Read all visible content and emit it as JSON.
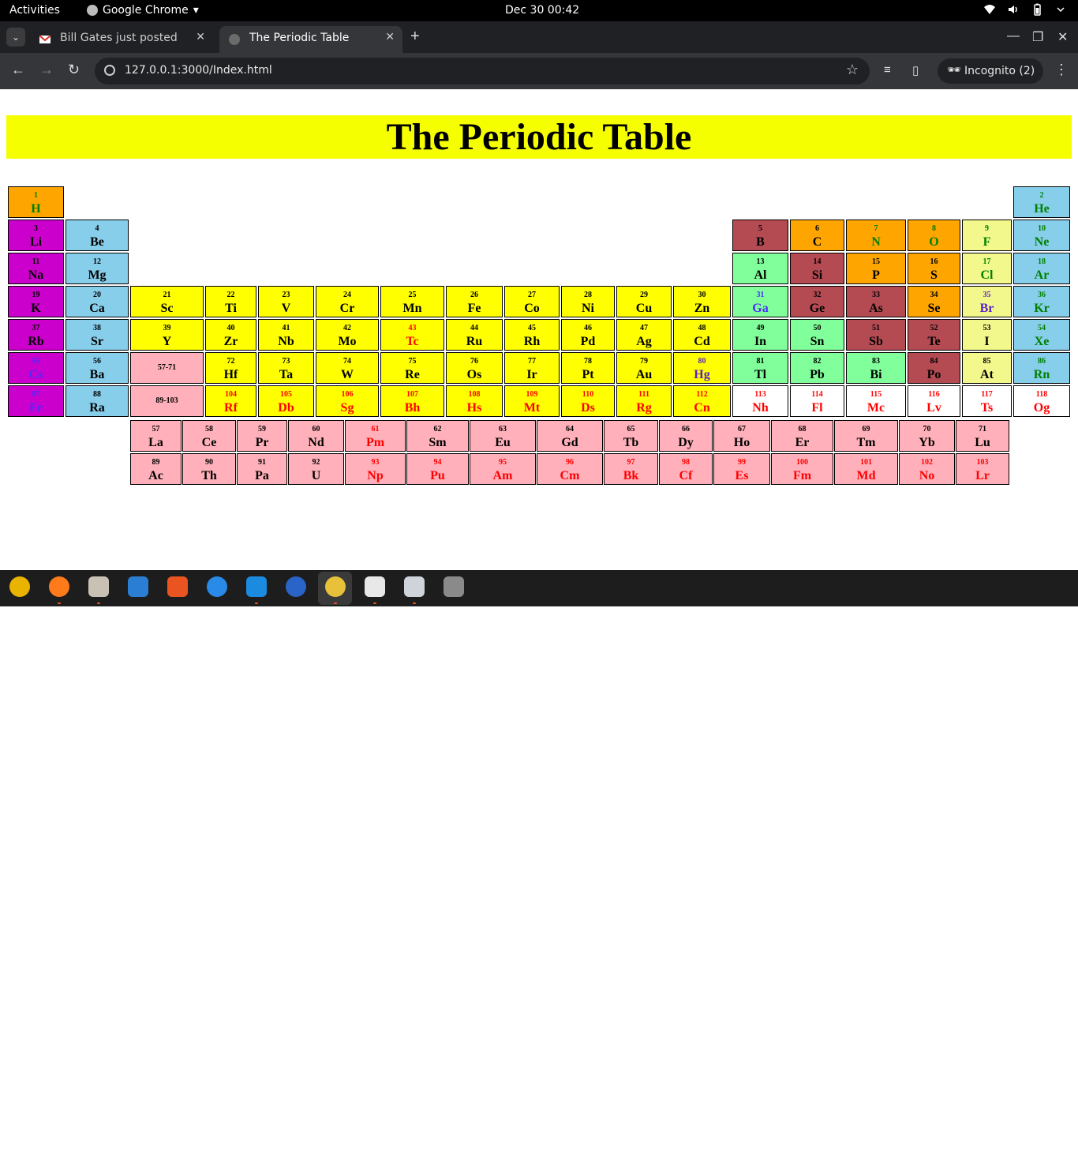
{
  "system_bar": {
    "activities": "Activities",
    "app_name": "Google Chrome",
    "clock": "Dec 30  00:42"
  },
  "tabs": [
    {
      "title": "Bill Gates just posted. Re",
      "active": false,
      "icon": "gmail-icon"
    },
    {
      "title": "The Periodic Table",
      "active": true,
      "icon": "globe-icon"
    }
  ],
  "toolbar": {
    "url": "127.0.0.1:3000/Index.html",
    "profile_label": "Incognito (2)"
  },
  "page": {
    "title": "The Periodic Table",
    "placeholder_lanthanides": "57-71",
    "placeholder_actinides": "89-103"
  },
  "colors": {
    "banner": "#f5ff00",
    "alkali_metal": "#cc00cc",
    "alkaline_earth": "#87ceeb",
    "transition_metal": "#ffff00",
    "post_transition": "#80ff9a",
    "metalloid": "#b44a52",
    "nonmetal": "#ffa500",
    "halogen": "#f2f88c",
    "noble_gas": "#87ceeb",
    "lanthanide_actinide": "#ffb0ba",
    "unknown": "#ffffff"
  },
  "elements": [
    {
      "n": "1",
      "s": "H",
      "p": 1,
      "g": 1,
      "bg": "orange",
      "tc": "green"
    },
    {
      "n": "2",
      "s": "He",
      "p": 1,
      "g": 18,
      "bg": "lightblue",
      "tc": "green"
    },
    {
      "n": "3",
      "s": "Li",
      "p": 2,
      "g": 1,
      "bg": "magenta",
      "tc": "black"
    },
    {
      "n": "4",
      "s": "Be",
      "p": 2,
      "g": 2,
      "bg": "lightblue",
      "tc": "black"
    },
    {
      "n": "5",
      "s": "B",
      "p": 2,
      "g": 13,
      "bg": "brown",
      "tc": "black"
    },
    {
      "n": "6",
      "s": "C",
      "p": 2,
      "g": 14,
      "bg": "orange",
      "tc": "black"
    },
    {
      "n": "7",
      "s": "N",
      "p": 2,
      "g": 15,
      "bg": "orange",
      "tc": "green"
    },
    {
      "n": "8",
      "s": "O",
      "p": 2,
      "g": 16,
      "bg": "orange",
      "tc": "green"
    },
    {
      "n": "9",
      "s": "F",
      "p": 2,
      "g": 17,
      "bg": "paleyellow",
      "tc": "green"
    },
    {
      "n": "10",
      "s": "Ne",
      "p": 2,
      "g": 18,
      "bg": "lightblue",
      "tc": "green"
    },
    {
      "n": "11",
      "s": "Na",
      "p": 3,
      "g": 1,
      "bg": "magenta",
      "tc": "black"
    },
    {
      "n": "12",
      "s": "Mg",
      "p": 3,
      "g": 2,
      "bg": "lightblue",
      "tc": "black"
    },
    {
      "n": "13",
      "s": "Al",
      "p": 3,
      "g": 13,
      "bg": "green",
      "tc": "black"
    },
    {
      "n": "14",
      "s": "Si",
      "p": 3,
      "g": 14,
      "bg": "brown",
      "tc": "black"
    },
    {
      "n": "15",
      "s": "P",
      "p": 3,
      "g": 15,
      "bg": "orange",
      "tc": "black"
    },
    {
      "n": "16",
      "s": "S",
      "p": 3,
      "g": 16,
      "bg": "orange",
      "tc": "black"
    },
    {
      "n": "17",
      "s": "Cl",
      "p": 3,
      "g": 17,
      "bg": "paleyellow",
      "tc": "green"
    },
    {
      "n": "18",
      "s": "Ar",
      "p": 3,
      "g": 18,
      "bg": "lightblue",
      "tc": "green"
    },
    {
      "n": "19",
      "s": "K",
      "p": 4,
      "g": 1,
      "bg": "magenta",
      "tc": "black"
    },
    {
      "n": "20",
      "s": "Ca",
      "p": 4,
      "g": 2,
      "bg": "lightblue",
      "tc": "black"
    },
    {
      "n": "21",
      "s": "Sc",
      "p": 4,
      "g": 3,
      "bg": "yellow",
      "tc": "black"
    },
    {
      "n": "22",
      "s": "Ti",
      "p": 4,
      "g": 4,
      "bg": "yellow",
      "tc": "black"
    },
    {
      "n": "23",
      "s": "V",
      "p": 4,
      "g": 5,
      "bg": "yellow",
      "tc": "black"
    },
    {
      "n": "24",
      "s": "Cr",
      "p": 4,
      "g": 6,
      "bg": "yellow",
      "tc": "black"
    },
    {
      "n": "25",
      "s": "Mn",
      "p": 4,
      "g": 7,
      "bg": "yellow",
      "tc": "black"
    },
    {
      "n": "26",
      "s": "Fe",
      "p": 4,
      "g": 8,
      "bg": "yellow",
      "tc": "black"
    },
    {
      "n": "27",
      "s": "Co",
      "p": 4,
      "g": 9,
      "bg": "yellow",
      "tc": "black"
    },
    {
      "n": "28",
      "s": "Ni",
      "p": 4,
      "g": 10,
      "bg": "yellow",
      "tc": "black"
    },
    {
      "n": "29",
      "s": "Cu",
      "p": 4,
      "g": 11,
      "bg": "yellow",
      "tc": "black"
    },
    {
      "n": "30",
      "s": "Zn",
      "p": 4,
      "g": 12,
      "bg": "yellow",
      "tc": "black"
    },
    {
      "n": "31",
      "s": "Ga",
      "p": 4,
      "g": 13,
      "bg": "green",
      "tc": "blue"
    },
    {
      "n": "32",
      "s": "Ge",
      "p": 4,
      "g": 14,
      "bg": "brown",
      "tc": "black"
    },
    {
      "n": "33",
      "s": "As",
      "p": 4,
      "g": 15,
      "bg": "brown",
      "tc": "black"
    },
    {
      "n": "34",
      "s": "Se",
      "p": 4,
      "g": 16,
      "bg": "orange",
      "tc": "black"
    },
    {
      "n": "35",
      "s": "Br",
      "p": 4,
      "g": 17,
      "bg": "paleyellow",
      "tc": "purple"
    },
    {
      "n": "36",
      "s": "Kr",
      "p": 4,
      "g": 18,
      "bg": "lightblue",
      "tc": "green"
    },
    {
      "n": "37",
      "s": "Rb",
      "p": 5,
      "g": 1,
      "bg": "magenta",
      "tc": "black"
    },
    {
      "n": "38",
      "s": "Sr",
      "p": 5,
      "g": 2,
      "bg": "lightblue",
      "tc": "black"
    },
    {
      "n": "39",
      "s": "Y",
      "p": 5,
      "g": 3,
      "bg": "yellow",
      "tc": "black"
    },
    {
      "n": "40",
      "s": "Zr",
      "p": 5,
      "g": 4,
      "bg": "yellow",
      "tc": "black"
    },
    {
      "n": "41",
      "s": "Nb",
      "p": 5,
      "g": 5,
      "bg": "yellow",
      "tc": "black"
    },
    {
      "n": "42",
      "s": "Mo",
      "p": 5,
      "g": 6,
      "bg": "yellow",
      "tc": "black"
    },
    {
      "n": "43",
      "s": "Tc",
      "p": 5,
      "g": 7,
      "bg": "yellow",
      "tc": "red"
    },
    {
      "n": "44",
      "s": "Ru",
      "p": 5,
      "g": 8,
      "bg": "yellow",
      "tc": "black"
    },
    {
      "n": "45",
      "s": "Rh",
      "p": 5,
      "g": 9,
      "bg": "yellow",
      "tc": "black"
    },
    {
      "n": "46",
      "s": "Pd",
      "p": 5,
      "g": 10,
      "bg": "yellow",
      "tc": "black"
    },
    {
      "n": "47",
      "s": "Ag",
      "p": 5,
      "g": 11,
      "bg": "yellow",
      "tc": "black"
    },
    {
      "n": "48",
      "s": "Cd",
      "p": 5,
      "g": 12,
      "bg": "yellow",
      "tc": "black"
    },
    {
      "n": "49",
      "s": "In",
      "p": 5,
      "g": 13,
      "bg": "green",
      "tc": "black"
    },
    {
      "n": "50",
      "s": "Sn",
      "p": 5,
      "g": 14,
      "bg": "green",
      "tc": "black"
    },
    {
      "n": "51",
      "s": "Sb",
      "p": 5,
      "g": 15,
      "bg": "brown",
      "tc": "black"
    },
    {
      "n": "52",
      "s": "Te",
      "p": 5,
      "g": 16,
      "bg": "brown",
      "tc": "black"
    },
    {
      "n": "53",
      "s": "I",
      "p": 5,
      "g": 17,
      "bg": "paleyellow",
      "tc": "black"
    },
    {
      "n": "54",
      "s": "Xe",
      "p": 5,
      "g": 18,
      "bg": "lightblue",
      "tc": "green"
    },
    {
      "n": "55",
      "s": "Cs",
      "p": 6,
      "g": 1,
      "bg": "magenta",
      "tc": "blue"
    },
    {
      "n": "56",
      "s": "Ba",
      "p": 6,
      "g": 2,
      "bg": "lightblue",
      "tc": "black"
    },
    {
      "n": "72",
      "s": "Hf",
      "p": 6,
      "g": 4,
      "bg": "yellow",
      "tc": "black"
    },
    {
      "n": "73",
      "s": "Ta",
      "p": 6,
      "g": 5,
      "bg": "yellow",
      "tc": "black"
    },
    {
      "n": "74",
      "s": "W",
      "p": 6,
      "g": 6,
      "bg": "yellow",
      "tc": "black"
    },
    {
      "n": "75",
      "s": "Re",
      "p": 6,
      "g": 7,
      "bg": "yellow",
      "tc": "black"
    },
    {
      "n": "76",
      "s": "Os",
      "p": 6,
      "g": 8,
      "bg": "yellow",
      "tc": "black"
    },
    {
      "n": "77",
      "s": "Ir",
      "p": 6,
      "g": 9,
      "bg": "yellow",
      "tc": "black"
    },
    {
      "n": "78",
      "s": "Pt",
      "p": 6,
      "g": 10,
      "bg": "yellow",
      "tc": "black"
    },
    {
      "n": "79",
      "s": "Au",
      "p": 6,
      "g": 11,
      "bg": "yellow",
      "tc": "black"
    },
    {
      "n": "80",
      "s": "Hg",
      "p": 6,
      "g": 12,
      "bg": "yellow",
      "tc": "purple"
    },
    {
      "n": "81",
      "s": "Tl",
      "p": 6,
      "g": 13,
      "bg": "green",
      "tc": "black"
    },
    {
      "n": "82",
      "s": "Pb",
      "p": 6,
      "g": 14,
      "bg": "green",
      "tc": "black"
    },
    {
      "n": "83",
      "s": "Bi",
      "p": 6,
      "g": 15,
      "bg": "green",
      "tc": "black"
    },
    {
      "n": "84",
      "s": "Po",
      "p": 6,
      "g": 16,
      "bg": "brown",
      "tc": "black"
    },
    {
      "n": "85",
      "s": "At",
      "p": 6,
      "g": 17,
      "bg": "paleyellow",
      "tc": "black"
    },
    {
      "n": "86",
      "s": "Rn",
      "p": 6,
      "g": 18,
      "bg": "lightblue",
      "tc": "green"
    },
    {
      "n": "87",
      "s": "Fr",
      "p": 7,
      "g": 1,
      "bg": "magenta",
      "tc": "blue"
    },
    {
      "n": "88",
      "s": "Ra",
      "p": 7,
      "g": 2,
      "bg": "lightblue",
      "tc": "black"
    },
    {
      "n": "104",
      "s": "Rf",
      "p": 7,
      "g": 4,
      "bg": "yellow",
      "tc": "red"
    },
    {
      "n": "105",
      "s": "Db",
      "p": 7,
      "g": 5,
      "bg": "yellow",
      "tc": "red"
    },
    {
      "n": "106",
      "s": "Sg",
      "p": 7,
      "g": 6,
      "bg": "yellow",
      "tc": "red"
    },
    {
      "n": "107",
      "s": "Bh",
      "p": 7,
      "g": 7,
      "bg": "yellow",
      "tc": "red"
    },
    {
      "n": "108",
      "s": "Hs",
      "p": 7,
      "g": 8,
      "bg": "yellow",
      "tc": "red"
    },
    {
      "n": "109",
      "s": "Mt",
      "p": 7,
      "g": 9,
      "bg": "yellow",
      "tc": "red"
    },
    {
      "n": "110",
      "s": "Ds",
      "p": 7,
      "g": 10,
      "bg": "yellow",
      "tc": "red"
    },
    {
      "n": "111",
      "s": "Rg",
      "p": 7,
      "g": 11,
      "bg": "yellow",
      "tc": "red"
    },
    {
      "n": "112",
      "s": "Cn",
      "p": 7,
      "g": 12,
      "bg": "yellow",
      "tc": "red"
    },
    {
      "n": "113",
      "s": "Nh",
      "p": 7,
      "g": 13,
      "bg": "white",
      "tc": "red"
    },
    {
      "n": "114",
      "s": "Fl",
      "p": 7,
      "g": 14,
      "bg": "white",
      "tc": "red"
    },
    {
      "n": "115",
      "s": "Mc",
      "p": 7,
      "g": 15,
      "bg": "white",
      "tc": "red"
    },
    {
      "n": "116",
      "s": "Lv",
      "p": 7,
      "g": 16,
      "bg": "white",
      "tc": "red"
    },
    {
      "n": "117",
      "s": "Ts",
      "p": 7,
      "g": 17,
      "bg": "white",
      "tc": "red"
    },
    {
      "n": "118",
      "s": "Og",
      "p": 7,
      "g": 18,
      "bg": "white",
      "tc": "red"
    }
  ],
  "lanthanides": [
    {
      "n": "57",
      "s": "La",
      "tc": "black"
    },
    {
      "n": "58",
      "s": "Ce",
      "tc": "black"
    },
    {
      "n": "59",
      "s": "Pr",
      "tc": "black"
    },
    {
      "n": "60",
      "s": "Nd",
      "tc": "black"
    },
    {
      "n": "61",
      "s": "Pm",
      "tc": "red"
    },
    {
      "n": "62",
      "s": "Sm",
      "tc": "black"
    },
    {
      "n": "63",
      "s": "Eu",
      "tc": "black"
    },
    {
      "n": "64",
      "s": "Gd",
      "tc": "black"
    },
    {
      "n": "65",
      "s": "Tb",
      "tc": "black"
    },
    {
      "n": "66",
      "s": "Dy",
      "tc": "black"
    },
    {
      "n": "67",
      "s": "Ho",
      "tc": "black"
    },
    {
      "n": "68",
      "s": "Er",
      "tc": "black"
    },
    {
      "n": "69",
      "s": "Tm",
      "tc": "black"
    },
    {
      "n": "70",
      "s": "Yb",
      "tc": "black"
    },
    {
      "n": "71",
      "s": "Lu",
      "tc": "black"
    }
  ],
  "actinides": [
    {
      "n": "89",
      "s": "Ac",
      "tc": "black"
    },
    {
      "n": "90",
      "s": "Th",
      "tc": "black"
    },
    {
      "n": "91",
      "s": "Pa",
      "tc": "black"
    },
    {
      "n": "92",
      "s": "U",
      "tc": "black"
    },
    {
      "n": "93",
      "s": "Np",
      "tc": "red"
    },
    {
      "n": "94",
      "s": "Pu",
      "tc": "red"
    },
    {
      "n": "95",
      "s": "Am",
      "tc": "red"
    },
    {
      "n": "96",
      "s": "Cm",
      "tc": "red"
    },
    {
      "n": "97",
      "s": "Bk",
      "tc": "red"
    },
    {
      "n": "98",
      "s": "Cf",
      "tc": "red"
    },
    {
      "n": "99",
      "s": "Es",
      "tc": "red"
    },
    {
      "n": "100",
      "s": "Fm",
      "tc": "red"
    },
    {
      "n": "101",
      "s": "Md",
      "tc": "red"
    },
    {
      "n": "102",
      "s": "No",
      "tc": "red"
    },
    {
      "n": "103",
      "s": "Lr",
      "tc": "red"
    }
  ],
  "dock": [
    {
      "icon": "rhythmbox-icon",
      "color": "#e8b400",
      "running": false
    },
    {
      "icon": "firefox-icon",
      "color": "#ff7a1a",
      "running": true
    },
    {
      "icon": "files-icon",
      "color": "#c9c1b4",
      "running": true
    },
    {
      "icon": "writer-icon",
      "color": "#2a7fd4",
      "running": false
    },
    {
      "icon": "software-icon",
      "color": "#e95420",
      "running": false
    },
    {
      "icon": "help-icon",
      "color": "#2a8ae8",
      "running": false
    },
    {
      "icon": "vscode-icon",
      "color": "#1b8be0",
      "running": true
    },
    {
      "icon": "thunderbird-icon",
      "color": "#2a64c8",
      "running": false
    },
    {
      "icon": "chrome-icon",
      "color": "#e8c13a",
      "running": true
    },
    {
      "icon": "text-editor-icon",
      "color": "#e8e8e8",
      "running": true
    },
    {
      "icon": "document-viewer-icon",
      "color": "#cfd4da",
      "running": true
    },
    {
      "icon": "usb-drive-icon",
      "color": "#8a8a8a",
      "running": false
    }
  ]
}
